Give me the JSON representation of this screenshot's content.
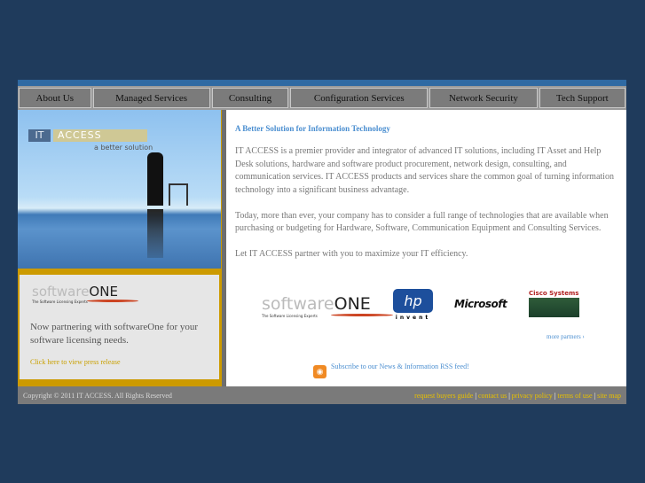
{
  "nav": [
    "About Us",
    "Managed Services",
    "Consulting",
    "Configuration Services",
    "Network Security",
    "Tech Support"
  ],
  "hero": {
    "logo_it": "IT",
    "logo_access": "ACCESS",
    "tagline": "a better solution"
  },
  "promo": {
    "logo_main": "software",
    "logo_one": "ONE",
    "logo_sub": "The Software Licensing Experts",
    "text": "Now partnering with softwareOne for your software licensing needs.",
    "link": "Click here to view press release"
  },
  "main": {
    "heading": "A Better Solution for Information Technology",
    "paragraphs": [
      "IT ACCESS is a premier provider and integrator of advanced IT solutions, including IT Asset and Help Desk solutions, hardware and software product procurement, network design, consulting, and communication services. IT ACCESS products and services share the common goal of turning information technology into a significant business advantage.",
      "Today, more than ever, your company has to consider a full range of technologies that are available when purchasing or budgeting for Hardware, Software, Communication Equipment and Consulting Services.",
      "Let IT ACCESS partner with you to maximize your IT efficiency."
    ],
    "partners": {
      "hp": "hp",
      "hp_sub": "invent",
      "microsoft": "Microsoft",
      "cisco": "Cisco Systems"
    },
    "more_partners": "more partners ›",
    "rss": "Subscribe to our News & Information RSS feed!"
  },
  "footer": {
    "copyright": "Copyright © 2011  IT ACCESS. All Rights Reserved",
    "links": [
      "request buyers guide",
      "contact us",
      "privacy policy",
      "terms of use",
      "site map"
    ]
  }
}
